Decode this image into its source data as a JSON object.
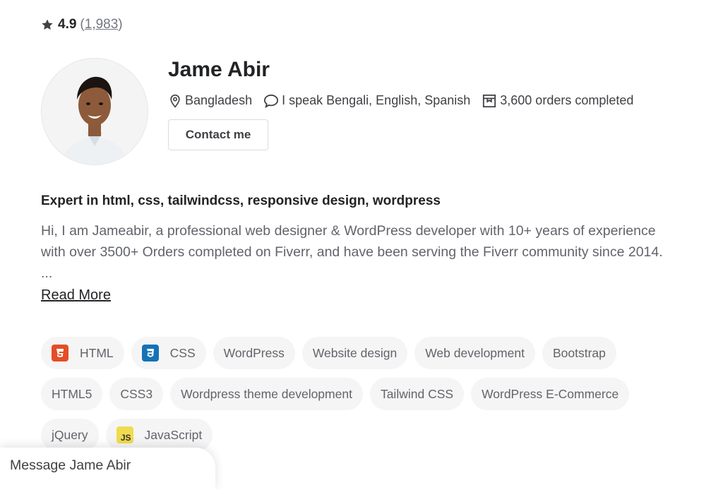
{
  "rating": {
    "score": "4.9",
    "open_paren": "(",
    "count": "1,983",
    "close_paren": ")"
  },
  "profile": {
    "name": "Jame Abir",
    "location": "Bangladesh",
    "languages": "I speak Bengali, English, Spanish",
    "orders": "3,600 orders completed",
    "contact_label": "Contact me"
  },
  "about": {
    "headline": "Expert in html, css, tailwindcss, responsive design, wordpress",
    "description": "Hi, I am Jameabir, a professional web designer & WordPress developer with 10+ years of experience with over 3500+ Orders completed on Fiverr, and have been serving the Fiverr community since 2014. ...",
    "read_more": "Read More"
  },
  "skills": {
    "row1": [
      {
        "label": "HTML",
        "icon": "html5-icon"
      },
      {
        "label": "CSS",
        "icon": "css3-icon"
      },
      {
        "label": "WordPress"
      },
      {
        "label": "Website design"
      },
      {
        "label": "Web development"
      },
      {
        "label": "Bootstrap"
      }
    ],
    "row2": [
      {
        "label": "HTML5"
      },
      {
        "label": "CSS3"
      },
      {
        "label": "Wordpress theme development"
      },
      {
        "label": "Tailwind CSS"
      },
      {
        "label": "WordPress E-Commerce"
      }
    ],
    "row3": [
      {
        "label": "jQuery"
      },
      {
        "label": "JavaScript",
        "icon": "javascript-icon",
        "icon_text": "JS"
      }
    ]
  },
  "message_bar": {
    "label": "Message Jame Abir"
  },
  "colors": {
    "html": "#e44d26",
    "css": "#1572b6",
    "js": "#f0db4f",
    "chip_bg": "#f5f5f5"
  }
}
